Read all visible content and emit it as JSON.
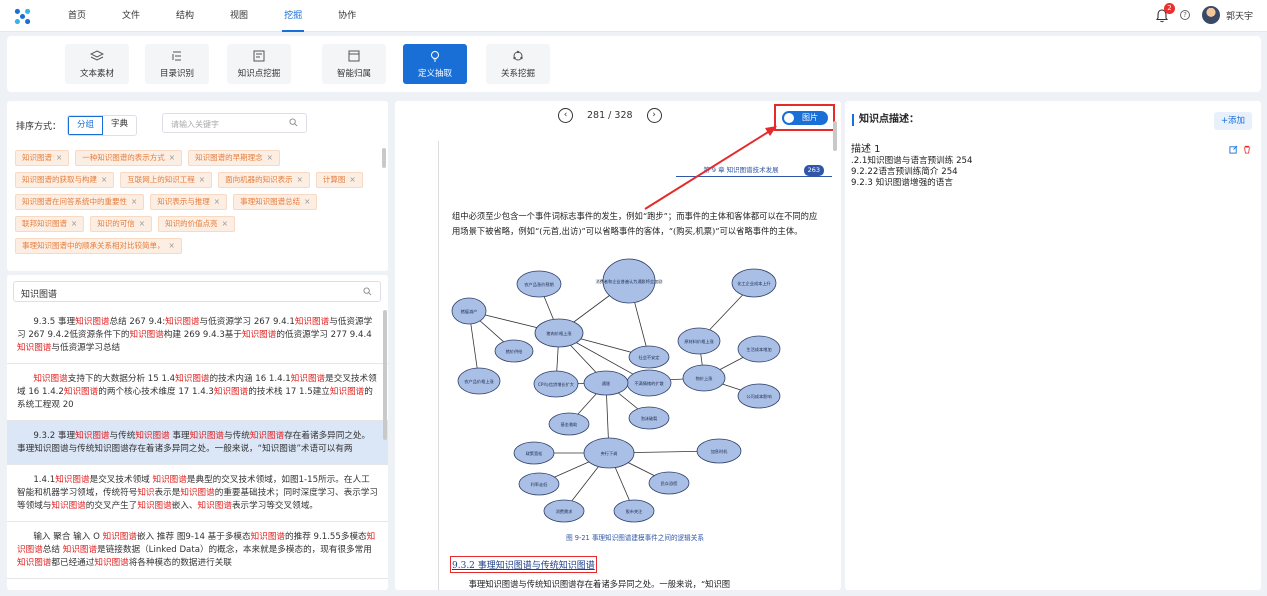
{
  "topbar": {
    "logo": "app-logo-icon",
    "menu": [
      {
        "label": "首页"
      },
      {
        "label": "文件"
      },
      {
        "label": "结构"
      },
      {
        "label": "视图"
      },
      {
        "label": "挖掘"
      },
      {
        "label": "协作"
      }
    ],
    "active_menu": "挖掘",
    "notification_count": "2",
    "help_glyph": "?",
    "user_name": "郭天宇",
    "accent": "#1a6fd6"
  },
  "toolbar": {
    "items": [
      {
        "label": "文本素材",
        "icon": "layers-icon"
      },
      {
        "label": "目录识别",
        "icon": "list-icon"
      },
      {
        "label": "知识点挖掘",
        "icon": "document-icon"
      },
      {
        "label": "智能归属",
        "icon": "window-icon"
      },
      {
        "label": "定义抽取",
        "icon": "bulb-icon"
      },
      {
        "label": "关系挖掘",
        "icon": "network-icon"
      }
    ],
    "active": "定义抽取"
  },
  "left": {
    "sort_label": "排序方式：",
    "sort_options": [
      "分组",
      "字典"
    ],
    "sort_active": "分组",
    "keyword_placeholder": "请输入关键字",
    "tags": [
      "知识图谱",
      "一种知识图谱的表示方式",
      "知识图谱的早期理念",
      "知识图谱的获取与构建",
      "互联网上的知识工程",
      "面向机器的知识表示",
      "计算图",
      "知识图谱在问答系统中的重要性",
      "知识表示与推理",
      "事理知识图谱总结",
      "联邦知识图谱",
      "知识的可信",
      "知识的价值点亮",
      "事理知识图谱中的顺承关系相对比较简单，"
    ],
    "tag_close": "×",
    "search_value": "知识图谱",
    "results": [
      {
        "parts": [
          "9.3.5 事理",
          "知识图谱",
          "总结 267 9.4:",
          "知识图谱",
          "与低资源学习 267 9.4.1",
          "知识图谱",
          "与低资源学习 267 9.4.2低资源条件下的",
          "知识图谱",
          "构建 269 9.4.3基于",
          "知识图谱",
          "的低资源学习 277 9.4.4",
          "知识图谱",
          "与低资源学习总结"
        ],
        "selected": false
      },
      {
        "parts": [
          "",
          "知识图谱",
          "支持下的大数据分析 15 1.4",
          "知识图谱",
          "的技术内涵 16 1.4.1",
          "知识图谱",
          "是交叉技术领域 16 1.4.2",
          "知识图谱",
          "的两个核心技术维度 17 1.4.3",
          "知识图谱",
          "的技术栈 17 1.5建立",
          "知识图谱",
          "的系统工程观 20"
        ],
        "selected": false
      },
      {
        "parts": [
          "9.3.2 事理",
          "知识图谱",
          "与传统",
          "知识图谱",
          " 事理",
          "知识图谱",
          "与传统",
          "知识图谱",
          "存在着诸多异同之处。事理知识图谱与传统知识图谱存在着诸多异同之处。一般来说，“知识图谱”术语可以有两"
        ],
        "selected": true
      },
      {
        "parts": [
          "1.4.1",
          "知识图谱",
          "是交叉技术领域 ",
          "知识图谱",
          "是典型的交叉技术领域，如图1-15所示。在人工智能和机器学习领域，传统符号",
          "知识",
          "表示是",
          "知识图谱",
          "的重要基础技术；同时深度学习、表示学习等领域与",
          "知识图谱",
          "的交叉产生了",
          "知识图谱",
          "嵌入、",
          "知识图谱",
          "表示学习等交叉领域。"
        ],
        "selected": false
      },
      {
        "parts": [
          "输入 聚合 输入 O ",
          "知识图谱",
          "嵌入 推荐 图9-14  基于多模态",
          "知识图谱",
          "的推荐 9.1.55多模态",
          "知识图谱",
          "总结 ",
          "知识图谱",
          "是链接数据（Linked Data）的概念，本来就是多模态的，现有很多常用",
          "知识图谱",
          "都已经通过",
          "知识图谱",
          "将各种模态的数据进行关联"
        ],
        "selected": false
      }
    ]
  },
  "doc": {
    "page_current": "281",
    "page_sep": "/",
    "page_total": "328",
    "toggle_label": "图片",
    "header_text": "第 9 章  知识图谱技术发展",
    "page_number": "263",
    "para1": "组中必须至少包含一个事件词标志事件的发生，例如“跑步”；而事件的主体和客体都可以在不同的应用场景下被省略，例如“(元首,出访)”可以省略事件的客体，“(购买,机票)”可以省略事件的主体。",
    "figure_caption": "图 9-21   事理知识图谱建模事件之间的逻辑关系",
    "section_title": "9.3.2   事理知识图谱与传统知识图谱",
    "para2": "事理知识图谱与传统知识图谱存在着诸多异同之处。一般来说，“知识图",
    "nodes": [
      "猪瘟减产",
      "农产品涨价预期",
      "猪肉价格上涨",
      "消费者和企业普遍认为通胀将会加剧",
      "社会不安定",
      "猪价供给",
      "不满情绪的扩散",
      "农产品价格上涨",
      "CPI与信贷增长扩大",
      "通胀",
      "物价上涨",
      "原材料价格上涨",
      "化工企业成本上升",
      "生活成本增加",
      "公司成本影响",
      "加息时机",
      "泡沫破裂",
      "央行下调",
      "政策宽松",
      "基金救助",
      "利率走低",
      "民众恐慌",
      "消费需求",
      "股市关注"
    ]
  },
  "right": {
    "title": "知识点描述：",
    "add_label": "+添加",
    "desc_title": "描述 1",
    "desc_lines": [
      ".2.1知识图谱与语言预训练 254",
      "9.2.22语言预训练简介 254",
      "9.2.3 知识图谱增强的语言"
    ]
  }
}
